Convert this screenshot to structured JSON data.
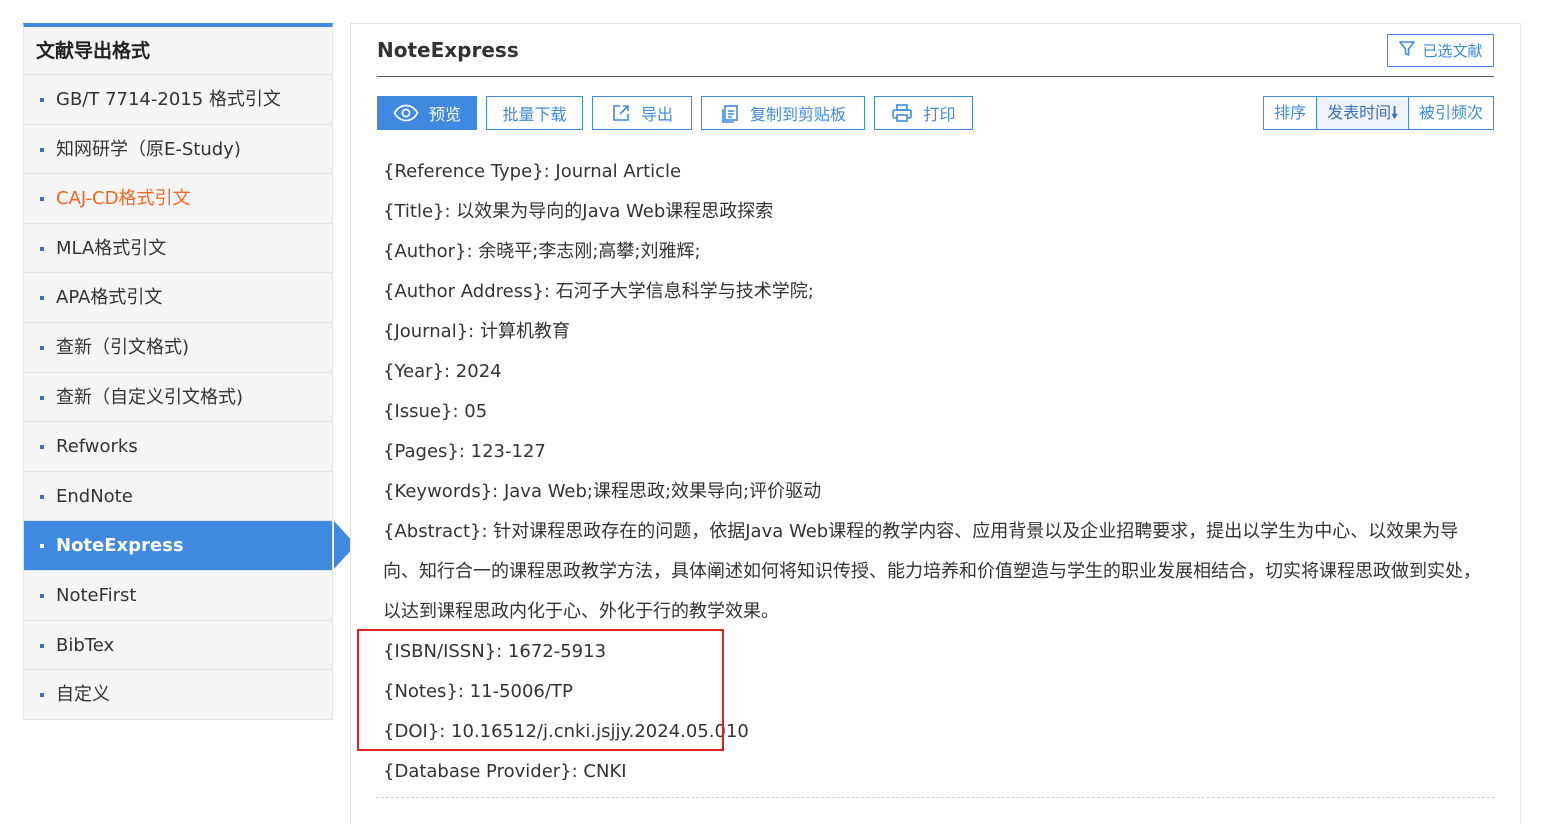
{
  "sidebar": {
    "title": "文献导出格式",
    "items": [
      {
        "label": "GB/T 7714-2015 格式引文",
        "state": "normal"
      },
      {
        "label": "知网研学（原E-Study)",
        "state": "normal"
      },
      {
        "label": "CAJ-CD格式引文",
        "state": "highlight"
      },
      {
        "label": "MLA格式引文",
        "state": "normal"
      },
      {
        "label": "APA格式引文",
        "state": "normal"
      },
      {
        "label": "查新（引文格式)",
        "state": "normal"
      },
      {
        "label": "查新（自定义引文格式)",
        "state": "normal"
      },
      {
        "label": "Refworks",
        "state": "normal"
      },
      {
        "label": "EndNote",
        "state": "normal"
      },
      {
        "label": "NoteExpress",
        "state": "active"
      },
      {
        "label": "NoteFirst",
        "state": "normal"
      },
      {
        "label": "BibTex",
        "state": "normal"
      },
      {
        "label": "自定义",
        "state": "normal"
      }
    ]
  },
  "main": {
    "title": "NoteExpress",
    "selected_label": "已选文献",
    "toolbar": {
      "preview": "预览",
      "batch_download": "批量下载",
      "export": "导出",
      "copy": "复制到剪贴板",
      "print": "打印"
    },
    "sort": {
      "label": "排序",
      "pub_time": "发表时间",
      "cited": "被引频次"
    },
    "record": [
      "{Reference Type}: Journal Article",
      "{Title}: 以效果为导向的Java Web课程思政探索",
      "{Author}: 余晓平;李志刚;高攀;刘雅辉;",
      "{Author Address}: 石河子大学信息科学与技术学院;",
      "{Journal}: 计算机教育",
      "{Year}: 2024",
      "{Issue}: 05",
      "{Pages}: 123-127",
      "{Keywords}: Java Web;课程思政;效果导向;评价驱动",
      "{Abstract}: 针对课程思政存在的问题，依据Java Web课程的教学内容、应用背景以及企业招聘要求，提出以学生为中心、以效果为导向、知行合一的课程思政教学方法，具体阐述如何将知识传授、能力培养和价值塑造与学生的职业发展相结合，切实将课程思政做到实处，以达到课程思政内化于心、外化于行的教学效果。",
      "{ISBN/ISSN}: 1672-5913",
      "{Notes}: 11-5006/TP",
      "{DOI}: 10.16512/j.cnki.jsjjy.2024.05.010",
      "{Database Provider}: CNKI"
    ]
  },
  "colors": {
    "accent": "#3f8ae0",
    "highlight_text": "#f26522",
    "annotation_box": "#e02020"
  }
}
